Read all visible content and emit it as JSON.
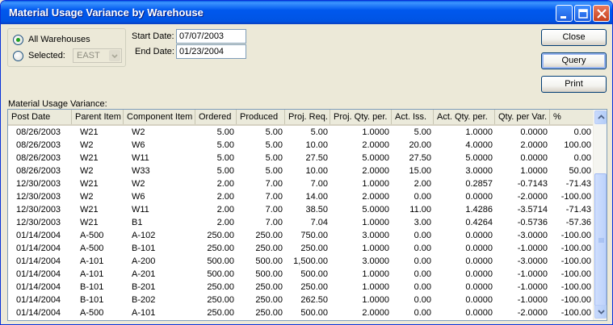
{
  "window": {
    "title": "Material Usage Variance by Warehouse"
  },
  "filters": {
    "all_warehouses_label": "All Warehouses",
    "selected_label": "Selected:",
    "warehouse_value": "EAST",
    "start_date_label": "Start Date:",
    "start_date_value": "07/07/2003",
    "end_date_label": "End Date:",
    "end_date_value": "01/23/2004"
  },
  "buttons": {
    "close": "Close",
    "query": "Query",
    "print": "Print"
  },
  "grid": {
    "label": "Material Usage Variance:",
    "columns": [
      "Post Date",
      "Parent Item",
      "Component Item",
      "Ordered",
      "Produced",
      "Proj. Req.",
      "Proj. Qty. per.",
      "Act. Iss.",
      "Act. Qty. per.",
      "Qty. per Var.",
      "%"
    ],
    "rows": [
      [
        "08/26/2003",
        "W21",
        "W2",
        "5.00",
        "5.00",
        "5.00",
        "1.0000",
        "5.00",
        "1.0000",
        "0.0000",
        "0.00"
      ],
      [
        "08/26/2003",
        "W2",
        "W6",
        "5.00",
        "5.00",
        "10.00",
        "2.0000",
        "20.00",
        "4.0000",
        "2.0000",
        "100.00"
      ],
      [
        "08/26/2003",
        "W21",
        "W11",
        "5.00",
        "5.00",
        "27.50",
        "5.0000",
        "27.50",
        "5.0000",
        "0.0000",
        "0.00"
      ],
      [
        "08/26/2003",
        "W2",
        "W33",
        "5.00",
        "5.00",
        "10.00",
        "2.0000",
        "15.00",
        "3.0000",
        "1.0000",
        "50.00"
      ],
      [
        "12/30/2003",
        "W21",
        "W2",
        "2.00",
        "7.00",
        "7.00",
        "1.0000",
        "2.00",
        "0.2857",
        "-0.7143",
        "-71.43"
      ],
      [
        "12/30/2003",
        "W2",
        "W6",
        "2.00",
        "7.00",
        "14.00",
        "2.0000",
        "0.00",
        "0.0000",
        "-2.0000",
        "-100.00"
      ],
      [
        "12/30/2003",
        "W21",
        "W11",
        "2.00",
        "7.00",
        "38.50",
        "5.0000",
        "11.00",
        "1.4286",
        "-3.5714",
        "-71.43"
      ],
      [
        "12/30/2003",
        "W21",
        "B1",
        "2.00",
        "7.00",
        "7.04",
        "1.0000",
        "3.00",
        "0.4264",
        "-0.5736",
        "-57.36"
      ],
      [
        "01/14/2004",
        "A-500",
        "A-102",
        "250.00",
        "250.00",
        "750.00",
        "3.0000",
        "0.00",
        "0.0000",
        "-3.0000",
        "-100.00"
      ],
      [
        "01/14/2004",
        "A-500",
        "B-101",
        "250.00",
        "250.00",
        "250.00",
        "1.0000",
        "0.00",
        "0.0000",
        "-1.0000",
        "-100.00"
      ],
      [
        "01/14/2004",
        "A-101",
        "A-200",
        "500.00",
        "500.00",
        "1,500.00",
        "3.0000",
        "0.00",
        "0.0000",
        "-3.0000",
        "-100.00"
      ],
      [
        "01/14/2004",
        "A-101",
        "A-201",
        "500.00",
        "500.00",
        "500.00",
        "1.0000",
        "0.00",
        "0.0000",
        "-1.0000",
        "-100.00"
      ],
      [
        "01/14/2004",
        "B-101",
        "B-201",
        "250.00",
        "250.00",
        "250.00",
        "1.0000",
        "0.00",
        "0.0000",
        "-1.0000",
        "-100.00"
      ],
      [
        "01/14/2004",
        "B-101",
        "B-202",
        "250.00",
        "250.00",
        "262.50",
        "1.0000",
        "0.00",
        "0.0000",
        "-1.0000",
        "-100.00"
      ],
      [
        "01/14/2004",
        "A-500",
        "A-101",
        "250.00",
        "250.00",
        "500.00",
        "2.0000",
        "0.00",
        "0.0000",
        "-2.0000",
        "-100.00"
      ]
    ]
  }
}
